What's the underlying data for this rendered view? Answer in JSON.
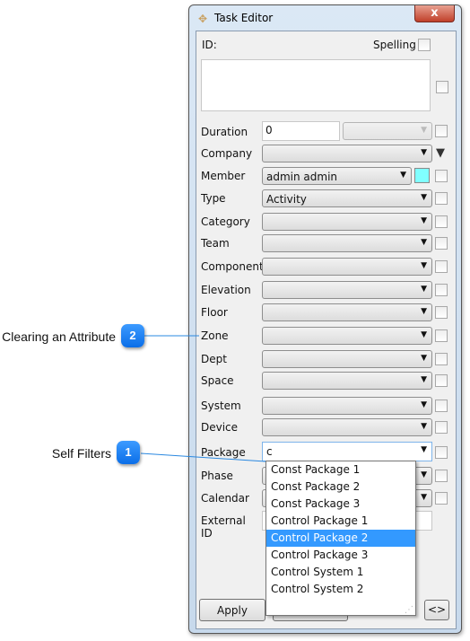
{
  "window": {
    "title": "Task Editor",
    "close_label": "x"
  },
  "id_label": "ID:",
  "spelling_label": "Spelling",
  "duration": {
    "label": "Duration",
    "value": "0"
  },
  "fields": [
    {
      "label": "Company",
      "value": "",
      "extra": "filter"
    },
    {
      "label": "Member",
      "value": "admin admin",
      "extra": "color",
      "color": "#80ffff"
    },
    {
      "label": "Type",
      "value": "Activity"
    },
    {
      "label": "Category",
      "value": ""
    },
    {
      "label": "Team",
      "value": ""
    },
    {
      "label": "Component",
      "value": ""
    },
    {
      "label": "Elevation",
      "value": ""
    },
    {
      "label": "Floor",
      "value": ""
    },
    {
      "label": "Zone",
      "value": ""
    },
    {
      "label": "Dept",
      "value": ""
    },
    {
      "label": "Space",
      "value": ""
    },
    {
      "label": "System",
      "value": ""
    },
    {
      "label": "Device",
      "value": ""
    },
    {
      "label": "Package",
      "value": "c",
      "editable": true
    },
    {
      "label": "Phase",
      "value": ""
    },
    {
      "label": "Calendar",
      "value": ""
    }
  ],
  "external_id": {
    "label": "External ID",
    "value": ""
  },
  "dropdown": {
    "items": [
      "Const Package 1",
      "Const Package 2",
      "Const Package 3",
      "Control Package 1",
      "Control Package 2",
      "Control Package 3",
      "Control System 1",
      "Control System 2"
    ],
    "selected": "Control Package 2"
  },
  "buttons": {
    "apply": "Apply",
    "toggle": "<>"
  },
  "callouts": [
    {
      "number": "2",
      "text": "Clearing an Attribute"
    },
    {
      "number": "1",
      "text": "Self Filters"
    }
  ],
  "colors": {
    "accent": "#3399ff",
    "badge": "#0a6ee8"
  }
}
